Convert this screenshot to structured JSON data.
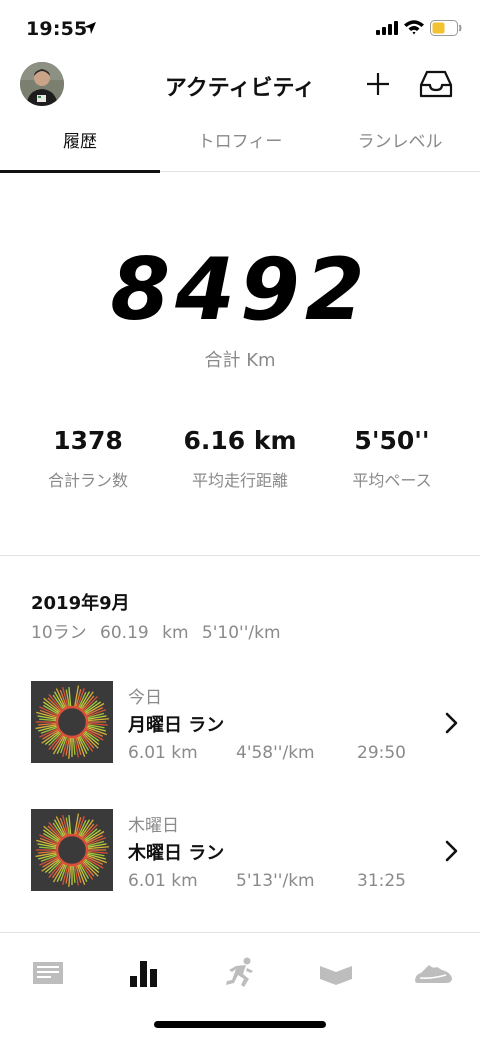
{
  "status": {
    "time": "19:55"
  },
  "header": {
    "title": "アクティビティ"
  },
  "tabs": [
    {
      "label": "履歴",
      "active": true
    },
    {
      "label": "トロフィー",
      "active": false
    },
    {
      "label": "ランレベル",
      "active": false
    }
  ],
  "summary": {
    "total_value": "8492",
    "total_label": "合計 Km",
    "stats": [
      {
        "value": "1378",
        "label": "合計ラン数"
      },
      {
        "value": "6.16 km",
        "label": "平均走行距離"
      },
      {
        "value": "5'50''",
        "label": "平均ペース"
      }
    ]
  },
  "month": {
    "title": "2019年9月",
    "summary": "10ラン 60.19 km 5'10''/km"
  },
  "runs": [
    {
      "day": "今日",
      "title": "月曜日 ラン",
      "distance": "6.01 km",
      "pace": "4'58''/km",
      "time": "29:50"
    },
    {
      "day": "木曜日",
      "title": "木曜日 ラン",
      "distance": "6.01 km",
      "pace": "5'13''/km",
      "time": "31:25"
    }
  ],
  "nav": [
    "feed-icon",
    "activity-icon",
    "run-icon",
    "plan-icon",
    "shoe-icon"
  ]
}
